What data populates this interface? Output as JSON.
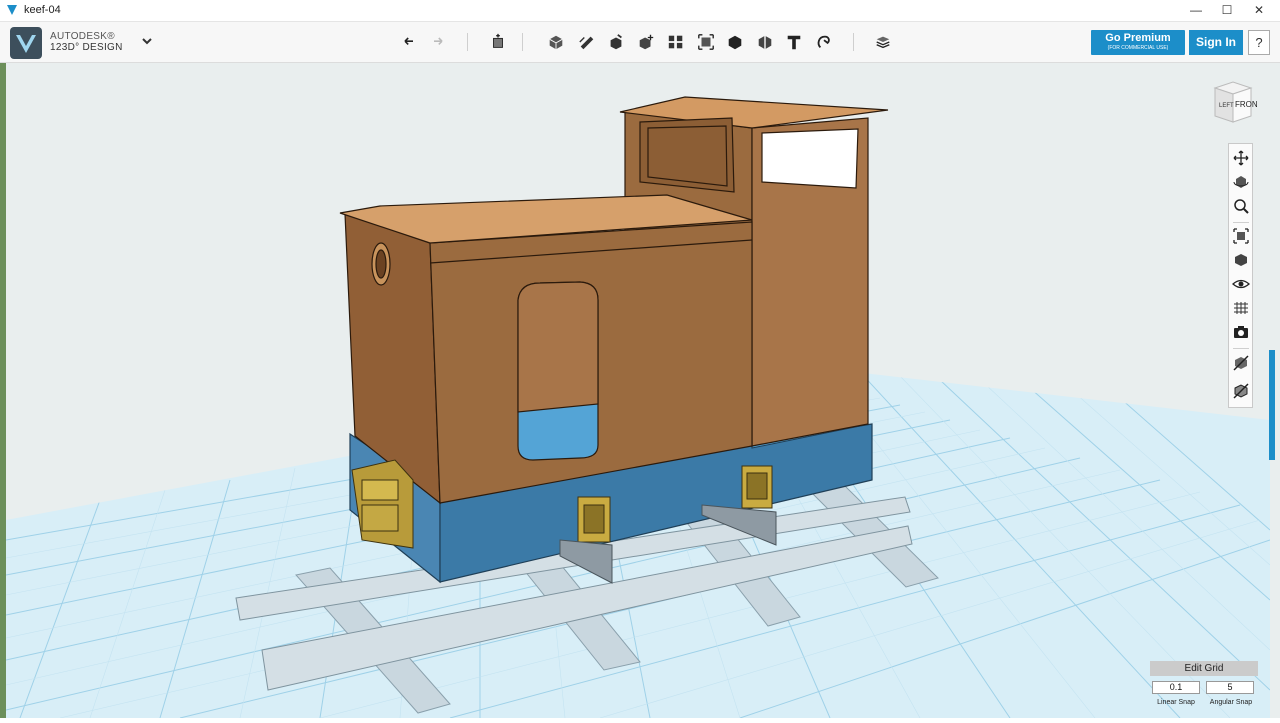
{
  "window": {
    "title": "keef-04",
    "minimize": "—",
    "maximize": "☐",
    "close": "✕"
  },
  "brand": {
    "line1": "AUTODESK®",
    "line2": "123D° DESIGN"
  },
  "toolbar": {
    "tools": [
      "undo-icon",
      "redo-icon",
      "transform-icon",
      "primitives-icon",
      "sketch-icon",
      "construct-icon",
      "modify-icon",
      "pattern-icon",
      "grouping-icon",
      "combine-icon",
      "measure-icon",
      "text-icon",
      "snap-icon",
      "material-icon"
    ],
    "premium_label": "Go Premium",
    "premium_sub": "(FOR COMMERCIAL USE)",
    "signin_label": "Sign In",
    "help_label": "?"
  },
  "viewcube": {
    "front_label": "FRONT",
    "left_label": "LEFT"
  },
  "navbar": {
    "tools": [
      "pan-icon",
      "orbit-icon",
      "zoom-icon",
      "fit-icon",
      "view-icon",
      "visibility-icon",
      "grid-visibility-icon",
      "screenshot-icon",
      "material-toggle-icon",
      "outline-toggle-icon"
    ]
  },
  "grid_panel": {
    "edit_grid_label": "Edit Grid",
    "linear_snap_value": "0.1",
    "angular_snap_value": "5",
    "linear_snap_label": "Linear Snap",
    "angular_snap_label": "Angular Snap"
  },
  "colors": {
    "accent": "#1c8ec9",
    "body_wood": "#9b6b3f",
    "roof_wood": "#d39a63",
    "chassis_blue": "#3b7aa7",
    "coupler_gold": "#b89b3a",
    "rail_grey": "#c9d7df",
    "grid_bg": "#d9eef7",
    "workspace_bg": "#e9eeee"
  }
}
